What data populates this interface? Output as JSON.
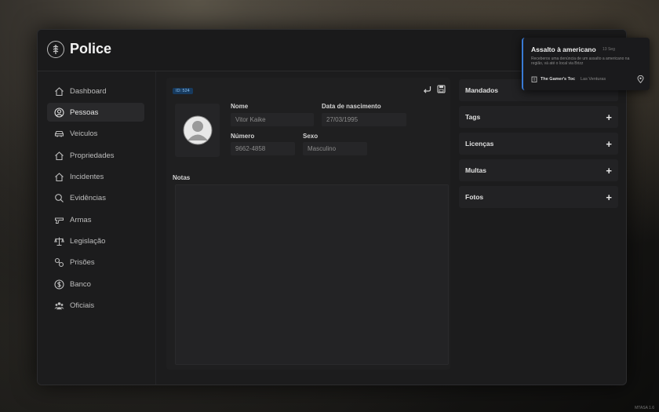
{
  "app": {
    "title": "Police"
  },
  "sidebar": {
    "items": [
      {
        "label": "Dashboard",
        "icon": "house-icon"
      },
      {
        "label": "Pessoas",
        "icon": "user-circle-icon",
        "active": true
      },
      {
        "label": "Veiculos",
        "icon": "car-icon"
      },
      {
        "label": "Propriedades",
        "icon": "house-icon"
      },
      {
        "label": "Incidentes",
        "icon": "house-icon"
      },
      {
        "label": "Evidências",
        "icon": "search-icon"
      },
      {
        "label": "Armas",
        "icon": "gun-icon"
      },
      {
        "label": "Legislação",
        "icon": "scale-icon"
      },
      {
        "label": "Prisões",
        "icon": "link-icon"
      },
      {
        "label": "Banco",
        "icon": "dollar-icon"
      },
      {
        "label": "Oficiais",
        "icon": "group-icon"
      }
    ]
  },
  "profile": {
    "id_badge": "ID: 524",
    "name_label": "Nome",
    "name_value": "Vitor Kaike",
    "dob_label": "Data de nascimento",
    "dob_value": "27/03/1995",
    "number_label": "Número",
    "number_value": "9662-4858",
    "sex_label": "Sexo",
    "sex_value": "Masculino",
    "notes_label": "Notas"
  },
  "right_panel": {
    "sections": [
      {
        "label": "Mandados"
      },
      {
        "label": "Tags"
      },
      {
        "label": "Licenças"
      },
      {
        "label": "Multas"
      },
      {
        "label": "Fotos"
      }
    ],
    "plus": "+"
  },
  "notification": {
    "title": "Assalto à americano",
    "time": "13 Seg",
    "body": "Receberos uma denúncia de um assalto a americano na região, vá até o local via Brizz",
    "place": "The Gamer's Toc",
    "area": "Las Venturas",
    "accent": "#3a7bd5"
  },
  "footer": {
    "version": "MTASA 1.6"
  }
}
